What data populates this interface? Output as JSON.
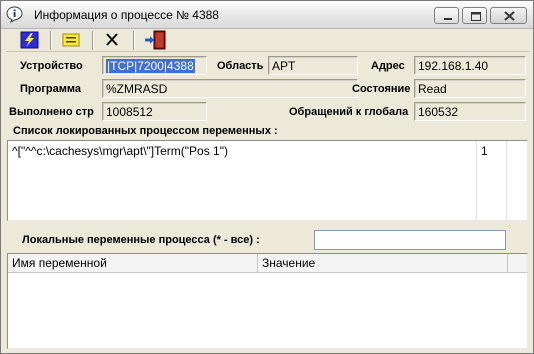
{
  "window": {
    "title": "Информация о процессе № 4388"
  },
  "toolbar": {
    "buttons": [
      {
        "name": "lightning-icon"
      },
      {
        "name": "note-icon"
      },
      {
        "name": "x-icon"
      },
      {
        "name": "exit-door-icon"
      }
    ]
  },
  "fields": {
    "device_label": "Устройство",
    "device_value": "|TCP|7200|4388",
    "area_label": "Область",
    "area_value": "APT",
    "address_label": "Адрес",
    "address_value": "192.168.1.40",
    "program_label": "Программа",
    "program_value": "%ZMRASD",
    "state_label": "Состояние",
    "state_value": "Read",
    "executed_label": "Выполнено стр",
    "executed_value": "1008512",
    "global_refs_label": "Обращений к глобала",
    "global_refs_value": "160532"
  },
  "locked_list": {
    "title": "Список локированных процессом переменных :",
    "rows": [
      {
        "variable": "^[\"^^c:\\cachesys\\mgr\\apt\\\"]Term(\"Pos 1\")",
        "count": "1"
      }
    ]
  },
  "local_vars": {
    "label": "Локальные переменные процесса (* - все) :",
    "filter_value": "",
    "columns": [
      "Имя переменной",
      "Значение"
    ]
  }
}
